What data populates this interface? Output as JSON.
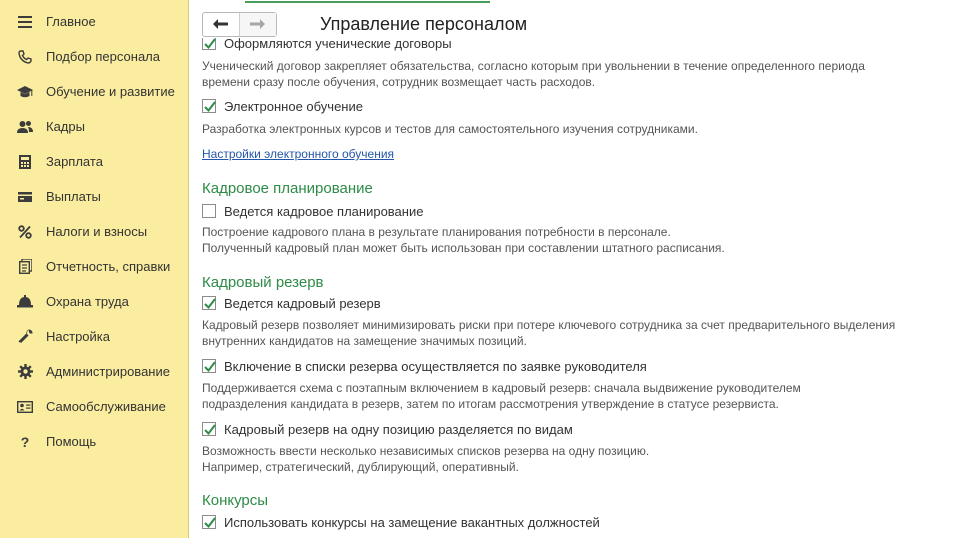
{
  "sidebar": {
    "items": [
      {
        "label": "Главное",
        "icon": "menu-icon"
      },
      {
        "label": "Подбор персонала",
        "icon": "phone-icon"
      },
      {
        "label": "Обучение и развитие",
        "icon": "graduation-cap-icon"
      },
      {
        "label": "Кадры",
        "icon": "people-icon"
      },
      {
        "label": "Зарплата",
        "icon": "calculator-icon"
      },
      {
        "label": "Выплаты",
        "icon": "wallet-icon"
      },
      {
        "label": "Налоги и взносы",
        "icon": "percent-icon"
      },
      {
        "label": "Отчетность, справки",
        "icon": "reports-icon"
      },
      {
        "label": "Охрана труда",
        "icon": "hard-hat-icon"
      },
      {
        "label": "Настройка",
        "icon": "wrench-icon"
      },
      {
        "label": "Администрирование",
        "icon": "gear-icon"
      },
      {
        "label": "Самообслуживание",
        "icon": "id-card-icon"
      },
      {
        "label": "Помощь",
        "icon": "question-icon"
      }
    ]
  },
  "header": {
    "title": "Управление персоналом"
  },
  "content": {
    "contracts": {
      "label": "Оформляются ученические договоры",
      "checked": true,
      "desc": [
        "Ученический договор закрепляет обязательства, согласно которым при увольнении в течение определенного периода",
        "времени сразу после обучения, сотрудник возмещает часть расходов."
      ]
    },
    "elearning": {
      "label": "Электронное обучение",
      "checked": true,
      "desc": "Разработка электронных курсов и тестов для самостоятельного изучения сотрудниками.",
      "link": "Настройки электронного обучения"
    },
    "planning": {
      "title": "Кадровое планирование",
      "label": "Ведется кадровое планирование",
      "checked": false,
      "desc": [
        "Построение кадрового плана в результате планирования потребности в персонале.",
        "Полученный кадровый план может быть использован при составлении штатного расписания."
      ]
    },
    "reserve": {
      "title": "Кадровый резерв",
      "main": {
        "label": "Ведется кадровый резерв",
        "checked": true,
        "desc": [
          "Кадровый резерв позволяет минимизировать риски при потере ключевого сотрудника за счет предварительного выделения",
          "внутренних кандидатов на замещение значимых позиций."
        ]
      },
      "by_request": {
        "label": "Включение в списки резерва осуществляется по заявке руководителя",
        "checked": true,
        "desc": [
          "Поддерживается схема с поэтапным включением в кадровый резерв: сначала выдвижение руководителем",
          "подразделения кандидата в резерв, затем по итогам рассмотрения утверждение в статусе резервиста."
        ]
      },
      "by_types": {
        "label": "Кадровый резерв на одну позицию разделяется по видам",
        "checked": true,
        "desc": [
          "Возможность ввести несколько независимых списков резерва на одну позицию.",
          "Например, стратегический, дублирующий, оперативный."
        ]
      }
    },
    "contests": {
      "title": "Конкурсы",
      "label": "Использовать конкурсы на замещение вакантных должностей",
      "checked": true
    }
  },
  "colors": {
    "sidebar_bg": "#fbeda0",
    "section_title": "#2e8b47",
    "checkmark": "#2e8b47",
    "link": "#2456a8"
  }
}
